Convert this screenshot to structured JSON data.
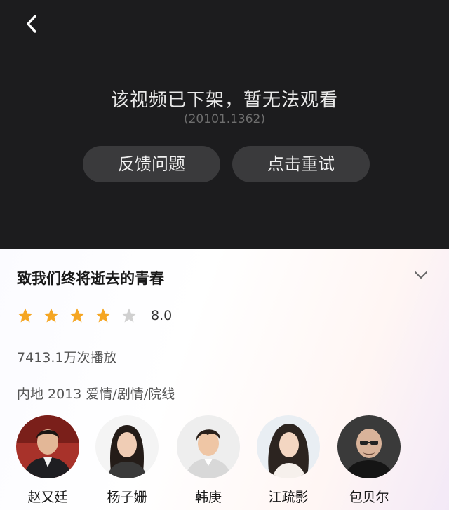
{
  "player": {
    "message": "该视频已下架，暂无法观看",
    "code": "(20101.1362)",
    "feedback_label": "反馈问题",
    "retry_label": "点击重试"
  },
  "video": {
    "title": "致我们终将逝去的青春",
    "rating": {
      "stars_filled": 4,
      "stars_total": 5,
      "score": "8.0"
    },
    "plays": "7413.1万次播放",
    "meta": "内地  2013  爱情/剧情/院线"
  },
  "cast": [
    {
      "name": "赵又廷"
    },
    {
      "name": "杨子姗"
    },
    {
      "name": "韩庚"
    },
    {
      "name": "江疏影"
    },
    {
      "name": "包贝尔"
    }
  ],
  "colors": {
    "star_filled": "#f5a623",
    "star_empty": "#d0d0d0",
    "player_bg": "#1c1c1e"
  }
}
